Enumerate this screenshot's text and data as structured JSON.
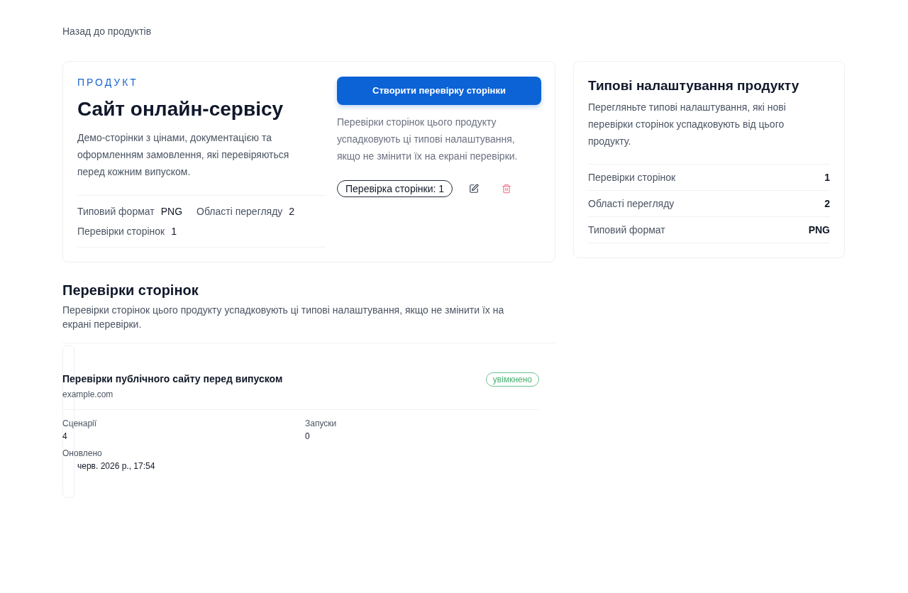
{
  "back_link": "Назад до продуктів",
  "product_card": {
    "eyebrow": "ПРОДУКТ",
    "title": "Сайт онлайн-сервісу",
    "description": "Демо-сторінки з цінами, документацією та оформленням замовлення, які перевіряються перед кожним випуском.",
    "stats": [
      {
        "label": "Типовий формат",
        "value": "PNG"
      },
      {
        "label": "Області перегляду",
        "value": "2"
      },
      {
        "label": "Перевірки сторінок",
        "value": "1"
      }
    ],
    "create_button": "Створити перевірку сторінки",
    "note": "Перевірки сторінок цього продукту успадковують ці типові налаштування, якщо не змінити їх на екрані перевірки.",
    "count_chip": "Перевірка сторінки: 1"
  },
  "defaults_panel": {
    "title": "Типові налаштування продукту",
    "description": "Перегляньте типові налаштування, які нові перевірки сторінок успадковують від цього продукту.",
    "rows": [
      {
        "label": "Перевірки сторінок",
        "value": "1"
      },
      {
        "label": "Області перегляду",
        "value": "2"
      },
      {
        "label": "Типовий формат",
        "value": "PNG"
      }
    ]
  },
  "page_checks": {
    "title": "Перевірки сторінок",
    "description": "Перевірки сторінок цього продукту успадковують ці типові налаштування, якщо не змінити їх на екрані перевірки.",
    "items": [
      {
        "title": "Перевірки публічного сайту перед випуском",
        "domain": "example.com",
        "status": "увімкнено",
        "fields": [
          {
            "label": "Сценарії",
            "value": "4"
          },
          {
            "label": "Запуски",
            "value": "0"
          },
          {
            "label": "Оновлено",
            "value": "черв. 2026 р., 17:54"
          }
        ]
      }
    ]
  }
}
